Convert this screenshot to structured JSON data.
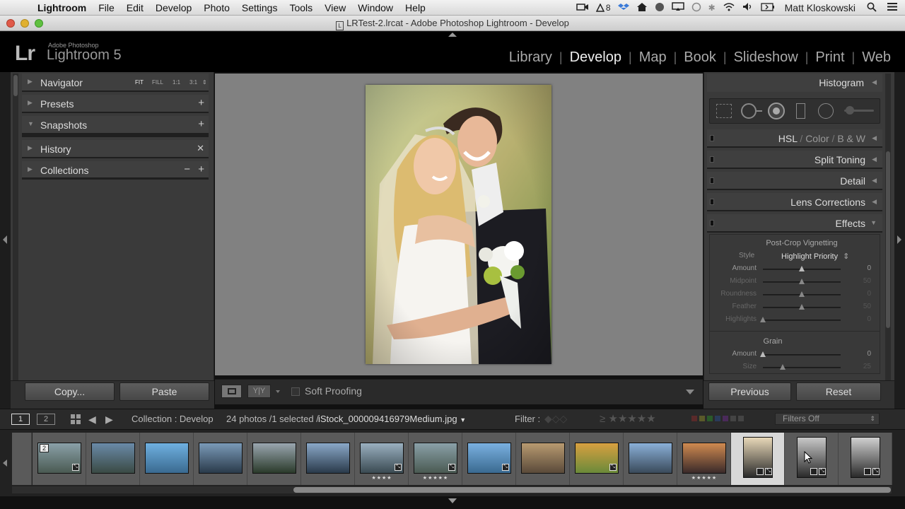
{
  "menubar": {
    "app": "Lightroom",
    "items": [
      "File",
      "Edit",
      "Develop",
      "Photo",
      "Settings",
      "Tools",
      "View",
      "Window",
      "Help"
    ],
    "tray_badge": "8",
    "user": "Matt Kloskowski"
  },
  "window": {
    "title": "LRTest-2.lrcat - Adobe Photoshop Lightroom - Develop"
  },
  "identity": {
    "brand_small": "Adobe Photoshop",
    "brand_name": "Lightroom 5",
    "logo": "Lr"
  },
  "modules": [
    "Library",
    "Develop",
    "Map",
    "Book",
    "Slideshow",
    "Print",
    "Web"
  ],
  "left_panel": {
    "navigator": {
      "label": "Navigator",
      "zoom": [
        "FIT",
        "FILL",
        "1:1",
        "3:1"
      ]
    },
    "presets": "Presets",
    "snapshots": "Snapshots",
    "history": "History",
    "collections": "Collections",
    "copy_button": "Copy...",
    "paste_button": "Paste"
  },
  "toolbar": {
    "soft_proofing": "Soft Proofing",
    "compare": "Y|Y"
  },
  "right_panel": {
    "histogram": "Histogram",
    "hsl": {
      "hsl": "HSL",
      "color": "Color",
      "bw": "B & W"
    },
    "split_toning": "Split Toning",
    "detail": "Detail",
    "lens_corrections": "Lens Corrections",
    "effects": "Effects",
    "vignette_title": "Post-Crop Vignetting",
    "style_label": "Style",
    "style_value": "Highlight Priority",
    "sliders": [
      {
        "label": "Amount",
        "value": "0",
        "pos": 0.5
      },
      {
        "label": "Midpoint",
        "value": "50",
        "pos": 0.5
      },
      {
        "label": "Roundness",
        "value": "0",
        "pos": 0.5
      },
      {
        "label": "Feather",
        "value": "50",
        "pos": 0.5
      },
      {
        "label": "Highlights",
        "value": "0",
        "pos": 0.0
      }
    ],
    "grain_title": "Grain",
    "grain_sliders": [
      {
        "label": "Amount",
        "value": "0",
        "pos": 0.0
      },
      {
        "label": "Size",
        "value": "25",
        "pos": 0.25
      }
    ],
    "previous_button": "Previous",
    "reset_button": "Reset"
  },
  "filmstrip": {
    "page1": "1",
    "page2": "2",
    "collection": "Collection : Develop",
    "count": "24 photos /1 selected /",
    "filename": "iStock_000009416979Medium.jpg",
    "filter_label": "Filter :",
    "filters_value": "Filters Off",
    "stack_badge": "2",
    "thumbs": [
      {
        "stars": "",
        "colors": [
          "#8aa0a8",
          "#4a5a52"
        ]
      },
      {
        "stars": "",
        "colors": [
          "#6a8aa8",
          "#3a4a44"
        ]
      },
      {
        "stars": "",
        "colors": [
          "#6fb0e0",
          "#3a6a90"
        ]
      },
      {
        "stars": "",
        "colors": [
          "#7a9ab8",
          "#2a3a4a"
        ]
      },
      {
        "stars": "",
        "colors": [
          "#9aa6b0",
          "#2a3a2a"
        ]
      },
      {
        "stars": "",
        "colors": [
          "#8aa8c8",
          "#2a3a4a"
        ]
      },
      {
        "stars": "★★★★",
        "colors": [
          "#9ab0c0",
          "#3a4a52"
        ]
      },
      {
        "stars": "★★★★★",
        "colors": [
          "#8aa0a8",
          "#4a5a52"
        ]
      },
      {
        "stars": "",
        "colors": [
          "#7ab0e0",
          "#3a6a90"
        ]
      },
      {
        "stars": "",
        "colors": [
          "#b89a70",
          "#5a4a3a"
        ]
      },
      {
        "stars": "",
        "colors": [
          "#d8a040",
          "#6a8a3a"
        ]
      },
      {
        "stars": "",
        "colors": [
          "#8ab0d8",
          "#3a4a5a"
        ]
      },
      {
        "stars": "★★★★★",
        "colors": [
          "#d08a50",
          "#3a2a2a"
        ]
      },
      {
        "stars": "",
        "colors": [
          "#e8d8b8",
          "#2a2a2a"
        ]
      },
      {
        "stars": "",
        "colors": [
          "#c8c8c8",
          "#2a2a2a"
        ]
      },
      {
        "stars": "",
        "colors": [
          "#d0d0d0",
          "#2a2a2a"
        ]
      }
    ]
  },
  "colors": {
    "accent": "#eeeeee",
    "panel": "#3a3a3a",
    "canvas": "#818181"
  }
}
